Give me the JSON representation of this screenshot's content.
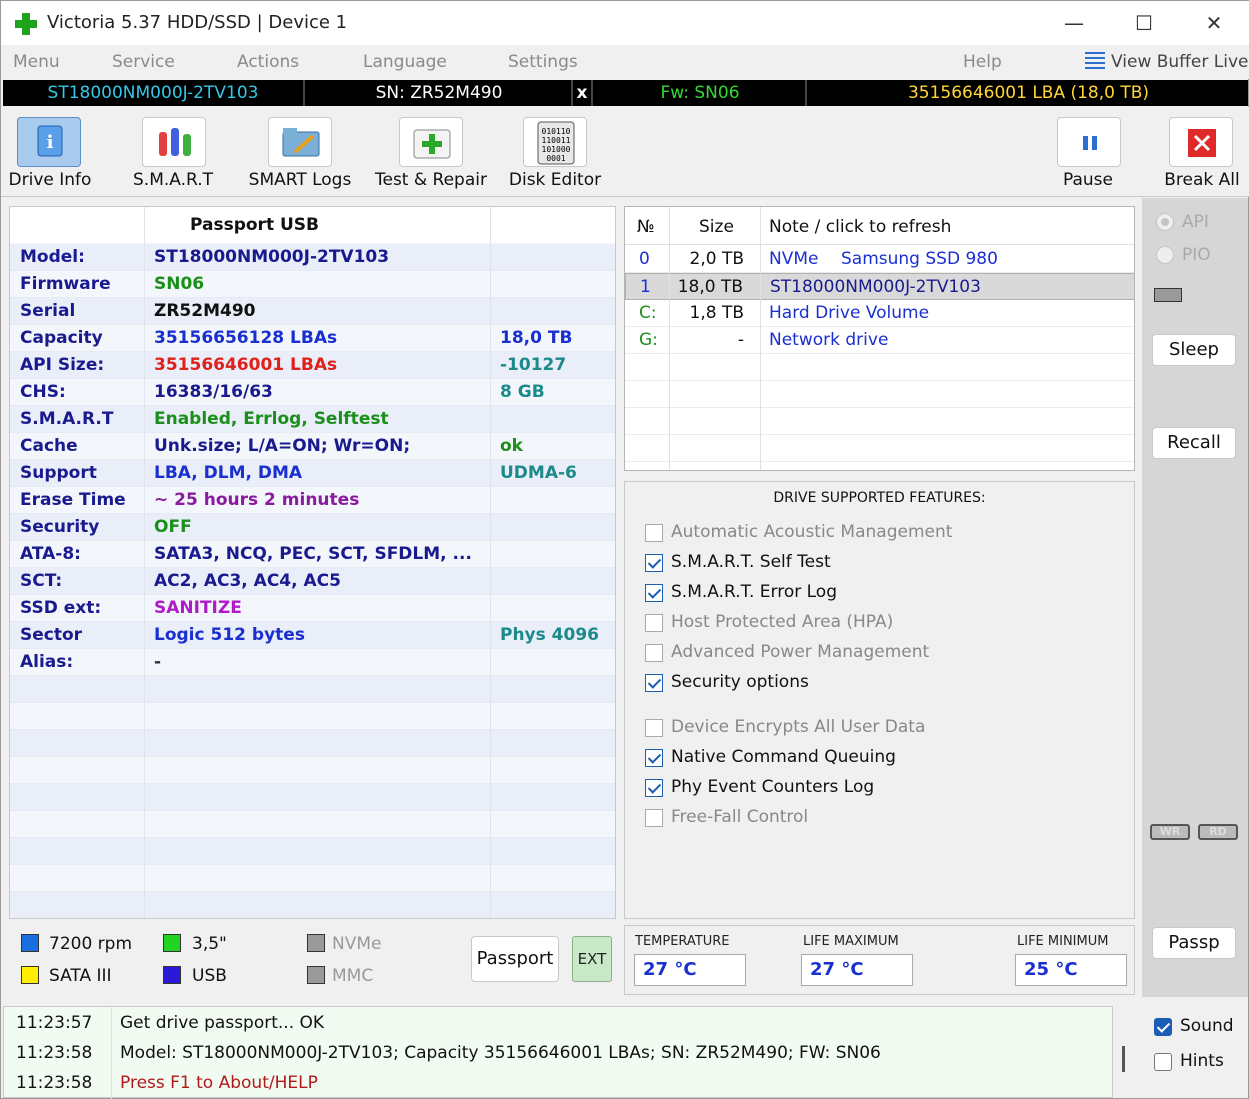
{
  "window": {
    "title": "Victoria 5.37 HDD/SSD | Device 1"
  },
  "menu": {
    "items": [
      "Menu",
      "Service",
      "Actions",
      "Language",
      "Settings",
      "Help"
    ],
    "view_buffer": "View Buffer Live"
  },
  "devbar": {
    "model": "ST18000NM000J-2TV103",
    "serial": "SN: ZR52M490",
    "close": "x",
    "firmware": "Fw: SN06",
    "lba": "35156646001 LBA (18,0 TB)"
  },
  "toolbar": {
    "drive_info": "Drive Info",
    "smart": "S.M.A.R.T",
    "smart_logs": "SMART Logs",
    "test_repair": "Test & Repair",
    "disk_editor": "Disk Editor",
    "pause": "Pause",
    "break_all": "Break All"
  },
  "passport": {
    "title": "Passport USB",
    "rows": [
      {
        "label": "Model:",
        "value": "ST18000NM000J-2TV103",
        "value_color": "#1a1a8f",
        "extra": "",
        "extra_color": "#1a8a8a"
      },
      {
        "label": "Firmware",
        "value": "SN06",
        "value_color": "#1a8f1a",
        "extra": "",
        "extra_color": "#1a8a8a"
      },
      {
        "label": "Serial",
        "value": "ZR52M490",
        "value_color": "#111111",
        "extra": "",
        "extra_color": "#1a8a8a"
      },
      {
        "label": "Capacity",
        "value": "35156656128 LBAs",
        "value_color": "#1a2fd0",
        "extra": "18,0 TB",
        "extra_color": "#1a2fd0"
      },
      {
        "label": "API Size:",
        "value": "35156646001 LBAs",
        "value_color": "#e0201a",
        "extra": "-10127",
        "extra_color": "#1a8a8a"
      },
      {
        "label": "CHS:",
        "value": "16383/16/63",
        "value_color": "#1a1a8f",
        "extra": "8 GB",
        "extra_color": "#1a8a8a"
      },
      {
        "label": "S.M.A.R.T",
        "value": "Enabled, Errlog, Selftest",
        "value_color": "#1a8f1a",
        "extra": "",
        "extra_color": "#1a8a8a"
      },
      {
        "label": "Cache",
        "value": "Unk.size; L/A=ON; Wr=ON;",
        "value_color": "#1a1a8f",
        "extra": "ok",
        "extra_color": "#1a8f1a"
      },
      {
        "label": "Support",
        "value": "LBA, DLM, DMA",
        "value_color": "#1a2fd0",
        "extra": "UDMA-6",
        "extra_color": "#1a8a8a"
      },
      {
        "label": "Erase Time",
        "value": "~ 25 hours 2 minutes",
        "value_color": "#8a1a9f",
        "extra": "",
        "extra_color": "#1a8a8a"
      },
      {
        "label": "Security",
        "value": "OFF",
        "value_color": "#1a8f1a",
        "extra": "",
        "extra_color": "#1a8a8a"
      },
      {
        "label": "ATA-8:",
        "value": "SATA3, NCQ, PEC, SCT, SFDLM, ...",
        "value_color": "#1a1a8f",
        "extra": "",
        "extra_color": "#1a8a8a"
      },
      {
        "label": "SCT:",
        "value": "AC2, AC3, AC4, AC5",
        "value_color": "#1a1a8f",
        "extra": "",
        "extra_color": "#1a8a8a"
      },
      {
        "label": "SSD ext:",
        "value": "SANITIZE",
        "value_color": "#b01ac9",
        "extra": "",
        "extra_color": "#1a8a8a"
      },
      {
        "label": "Sector",
        "value": "Logic 512 bytes",
        "value_color": "#1a2fd0",
        "extra": "Phys 4096",
        "extra_color": "#1a8a8a"
      },
      {
        "label": "Alias:",
        "value": " -",
        "value_color": "#333333",
        "extra": "",
        "extra_color": "#1a8a8a"
      }
    ]
  },
  "drives": {
    "headers": [
      "№",
      "Size",
      "Note / click to refresh"
    ],
    "rows": [
      {
        "id": "0",
        "size": "2,0 TB",
        "type": "NVMe",
        "note": "Samsung SSD 980",
        "id_color": "#1a2fd0"
      },
      {
        "id": "1",
        "size": "18,0 TB",
        "type": "",
        "note": "ST18000NM000J-2TV103",
        "id_color": "#1a2fd0"
      },
      {
        "id": "C:",
        "size": "1,8 TB",
        "type": "",
        "note": "Hard Drive Volume",
        "id_color": "#1a8f1a"
      },
      {
        "id": "G:",
        "size": "-",
        "type": "",
        "note": "Network drive",
        "id_color": "#1a8f1a"
      }
    ]
  },
  "features": {
    "title": "DRIVE SUPPORTED FEATURES:",
    "items": [
      {
        "label": "Automatic Acoustic Management",
        "checked": false
      },
      {
        "label": "S.M.A.R.T. Self Test",
        "checked": true
      },
      {
        "label": "S.M.A.R.T. Error Log",
        "checked": true
      },
      {
        "label": "Host Protected Area (HPA)",
        "checked": false
      },
      {
        "label": "Advanced Power Management",
        "checked": false
      },
      {
        "label": "Security options",
        "checked": true
      },
      {
        "label": "Device Encrypts All User Data",
        "checked": false
      },
      {
        "label": "Native Command Queuing",
        "checked": true
      },
      {
        "label": "Phy Event Counters Log",
        "checked": true
      },
      {
        "label": "Free-Fall Control",
        "checked": false
      }
    ]
  },
  "side": {
    "api": "API",
    "pio": "PIO",
    "sleep": "Sleep",
    "recall": "Recall",
    "wr": "WR",
    "rd": "RD",
    "passp": "Passp"
  },
  "binfo": {
    "rpm": "7200 rpm",
    "form": "3,5\"",
    "nvme": "NVMe",
    "sata": "SATA III",
    "usb": "USB",
    "mmc": "MMC",
    "passport_btn": "Passport",
    "ext_btn": "EXT"
  },
  "temperature": {
    "temp_label": "TEMPERATURE",
    "temp_value": "27 °C",
    "max_label": "LIFE MAXIMUM",
    "max_value": "27 °C",
    "min_label": "LIFE MINIMUM",
    "min_value": "25 °C"
  },
  "log": [
    {
      "time": "11:23:57",
      "msg": "Get drive passport... OK",
      "color": "#111111"
    },
    {
      "time": "11:23:58",
      "msg": "Model: ST18000NM000J-2TV103; Capacity 35156646001 LBAs; SN: ZR52M490; FW: SN06",
      "color": "#111111"
    },
    {
      "time": "11:23:58",
      "msg": "Press F1 to About/HELP",
      "color": "#b01a1a"
    }
  ],
  "sound": {
    "sound": "Sound",
    "hints": "Hints"
  },
  "colors": {
    "devbar_model": "#33c8e8",
    "devbar_serial": "#ffffff",
    "devbar_fw": "#33d833",
    "devbar_lba": "#ffd633"
  }
}
